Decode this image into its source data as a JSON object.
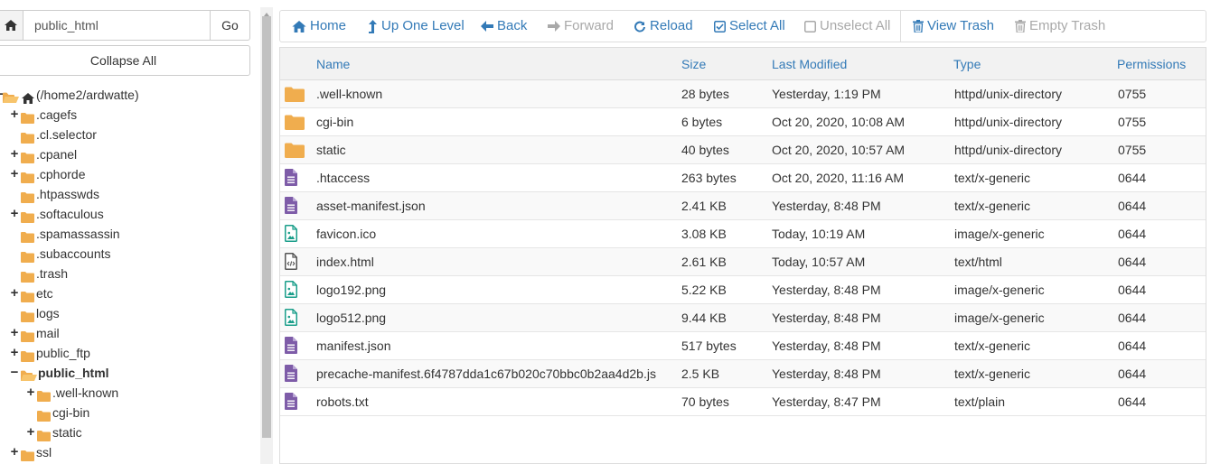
{
  "path_bar": {
    "path_value": "public_html",
    "go_label": "Go"
  },
  "collapse_all_label": "Collapse All",
  "tree": [
    {
      "label": "(/home2/ardwatte)",
      "toggle": "−",
      "depth": 0,
      "root": true,
      "open": true
    },
    {
      "label": ".cagefs",
      "toggle": "+",
      "depth": 1
    },
    {
      "label": ".cl.selector",
      "toggle": "",
      "depth": 1
    },
    {
      "label": ".cpanel",
      "toggle": "+",
      "depth": 1
    },
    {
      "label": ".cphorde",
      "toggle": "+",
      "depth": 1
    },
    {
      "label": ".htpasswds",
      "toggle": "",
      "depth": 1
    },
    {
      "label": ".softaculous",
      "toggle": "+",
      "depth": 1
    },
    {
      "label": ".spamassassin",
      "toggle": "",
      "depth": 1
    },
    {
      "label": ".subaccounts",
      "toggle": "",
      "depth": 1
    },
    {
      "label": ".trash",
      "toggle": "",
      "depth": 1
    },
    {
      "label": "etc",
      "toggle": "+",
      "depth": 1
    },
    {
      "label": "logs",
      "toggle": "",
      "depth": 1
    },
    {
      "label": "mail",
      "toggle": "+",
      "depth": 1
    },
    {
      "label": "public_ftp",
      "toggle": "+",
      "depth": 1
    },
    {
      "label": "public_html",
      "toggle": "−",
      "depth": 1,
      "bold": true,
      "open": true
    },
    {
      "label": ".well-known",
      "toggle": "+",
      "depth": 2
    },
    {
      "label": "cgi-bin",
      "toggle": "",
      "depth": 2
    },
    {
      "label": "static",
      "toggle": "+",
      "depth": 2
    },
    {
      "label": "ssl",
      "toggle": "+",
      "depth": 1
    }
  ],
  "toolbar": {
    "home": "Home",
    "up_one_level": "Up One Level",
    "back": "Back",
    "forward": "Forward",
    "reload": "Reload",
    "select_all": "Select All",
    "unselect_all": "Unselect All",
    "view_trash": "View Trash",
    "empty_trash": "Empty Trash"
  },
  "table": {
    "columns": [
      "Name",
      "Size",
      "Last Modified",
      "Type",
      "Permissions"
    ],
    "rows": [
      {
        "icon": "folder-icon",
        "name": ".well-known",
        "size": "28 bytes",
        "modified": "Yesterday, 1:19 PM",
        "type": "httpd/unix-directory",
        "perms": "0755"
      },
      {
        "icon": "folder-icon",
        "name": "cgi-bin",
        "size": "6 bytes",
        "modified": "Oct 20, 2020, 10:08 AM",
        "type": "httpd/unix-directory",
        "perms": "0755"
      },
      {
        "icon": "folder-icon",
        "name": "static",
        "size": "40 bytes",
        "modified": "Oct 20, 2020, 10:57 AM",
        "type": "httpd/unix-directory",
        "perms": "0755"
      },
      {
        "icon": "text-file-icon",
        "name": ".htaccess",
        "size": "263 bytes",
        "modified": "Oct 20, 2020, 11:16 AM",
        "type": "text/x-generic",
        "perms": "0644"
      },
      {
        "icon": "text-file-icon",
        "name": "asset-manifest.json",
        "size": "2.41 KB",
        "modified": "Yesterday, 8:48 PM",
        "type": "text/x-generic",
        "perms": "0644"
      },
      {
        "icon": "image-file-icon",
        "name": "favicon.ico",
        "size": "3.08 KB",
        "modified": "Today, 10:19 AM",
        "type": "image/x-generic",
        "perms": "0644"
      },
      {
        "icon": "code-file-icon",
        "name": "index.html",
        "size": "2.61 KB",
        "modified": "Today, 10:57 AM",
        "type": "text/html",
        "perms": "0644"
      },
      {
        "icon": "image-file-icon",
        "name": "logo192.png",
        "size": "5.22 KB",
        "modified": "Yesterday, 8:48 PM",
        "type": "image/x-generic",
        "perms": "0644"
      },
      {
        "icon": "image-file-icon",
        "name": "logo512.png",
        "size": "9.44 KB",
        "modified": "Yesterday, 8:48 PM",
        "type": "image/x-generic",
        "perms": "0644"
      },
      {
        "icon": "text-file-icon",
        "name": "manifest.json",
        "size": "517 bytes",
        "modified": "Yesterday, 8:48 PM",
        "type": "text/x-generic",
        "perms": "0644"
      },
      {
        "icon": "text-file-icon",
        "name": "precache-manifest.6f4787dda1c67b020c70bbc0b2aa4d2b.js",
        "size": "2.5 KB",
        "modified": "Yesterday, 8:48 PM",
        "type": "text/x-generic",
        "perms": "0644"
      },
      {
        "icon": "text-file-icon",
        "name": "robots.txt",
        "size": "70 bytes",
        "modified": "Yesterday, 8:47 PM",
        "type": "text/plain",
        "perms": "0644"
      }
    ]
  },
  "colors": {
    "link": "#337ab7",
    "disabled": "#a9a9a9",
    "folder": "#f0ad4e",
    "text_file": "#7e5ca8",
    "image_file": "#1a9e8a",
    "code_file": "#555555"
  }
}
